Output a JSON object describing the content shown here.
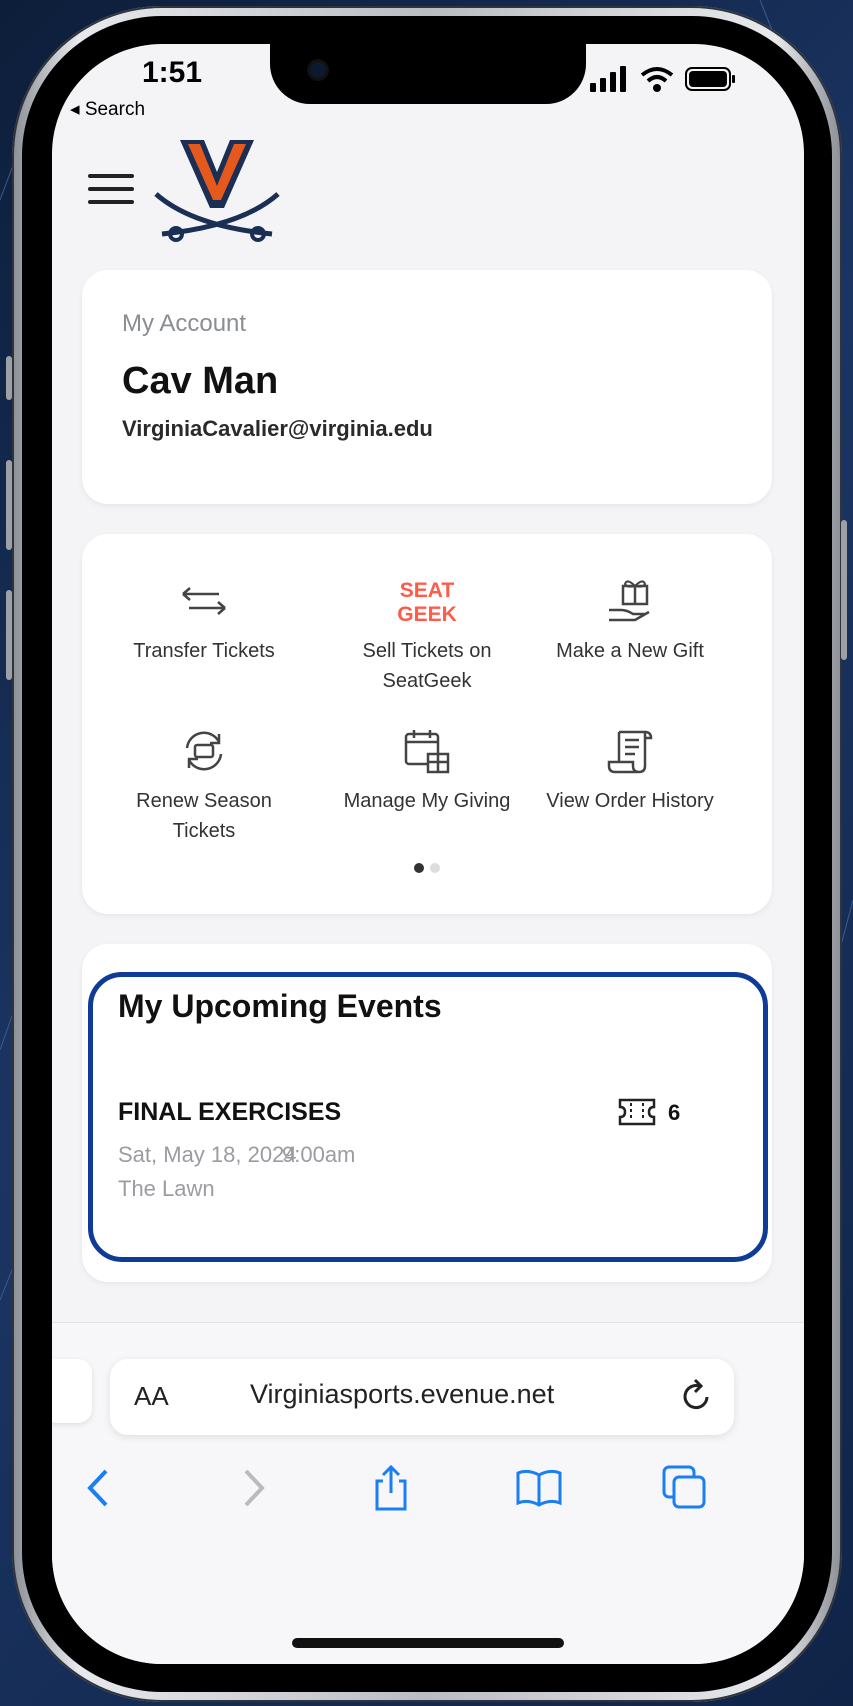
{
  "status_bar": {
    "time": "1:51",
    "back_label": "◂ Search"
  },
  "header": {
    "menu_icon": "hamburger-menu-icon",
    "logo": "virginia-cavaliers-logo"
  },
  "account": {
    "label": "My Account",
    "name": "Cav Man",
    "email": "VirginiaCavalier@virginia.edu"
  },
  "quick_actions": [
    {
      "label": "Transfer Tickets",
      "icon": "transfer-arrows-icon"
    },
    {
      "label": "Sell Tickets on SeatGeek",
      "icon": "seatgeek-logo-icon",
      "icon_text_1": "SEAT",
      "icon_text_2": "GEEK"
    },
    {
      "label": "Make a New Gift",
      "icon": "gift-hand-icon"
    },
    {
      "label": "Renew Season Tickets",
      "icon": "renew-ticket-icon"
    },
    {
      "label": "Manage My Giving",
      "icon": "calendar-gift-icon"
    },
    {
      "label": "View Order History",
      "icon": "receipt-scroll-icon"
    }
  ],
  "pagination": {
    "pages": 2,
    "active": 1
  },
  "upcoming_events": {
    "title": "My Upcoming Events",
    "events": [
      {
        "name": "FINAL EXERCISES",
        "date": "Sat, May 18, 2024",
        "time": "9:00am",
        "location": "The Lawn",
        "ticket_count": "6"
      }
    ]
  },
  "safari": {
    "text_size_label": "AA",
    "url": "Virginiasports.evenue.net"
  },
  "colors": {
    "brand_orange": "#e5591c",
    "brand_navy": "#1b2f55",
    "highlight_blue": "#0d3b96",
    "safari_blue": "#1a7ef5",
    "seatgeek_red": "#ff5b49"
  }
}
